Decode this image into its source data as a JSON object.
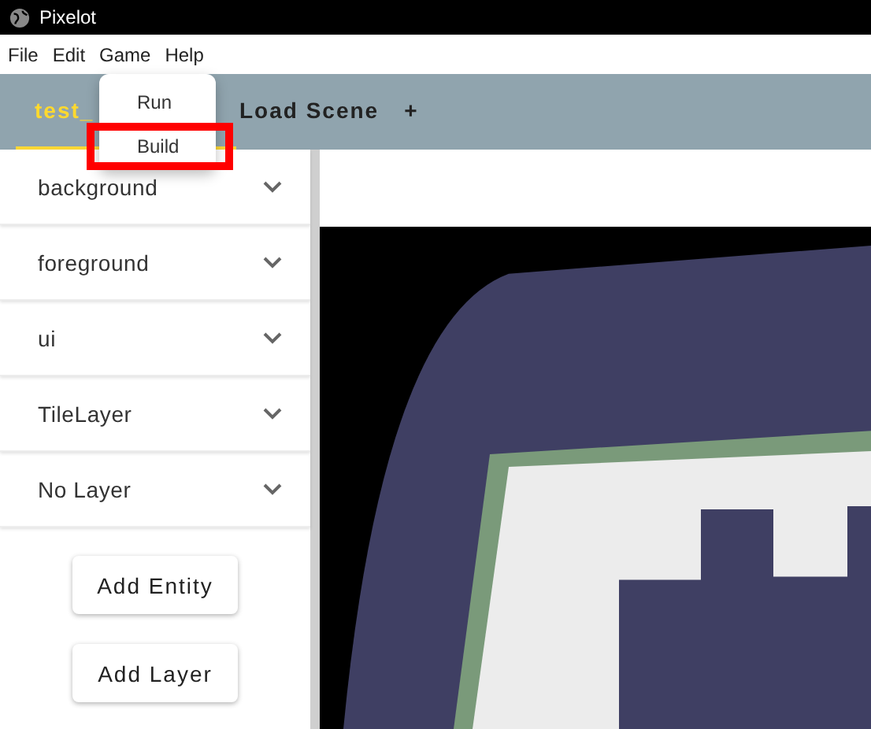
{
  "window": {
    "title": "Pixelot"
  },
  "menu_bar": [
    "File",
    "Edit",
    "Game",
    "Help"
  ],
  "open_menu": {
    "items": [
      {
        "label": "Run",
        "highlighted": false
      },
      {
        "label": "Build",
        "highlighted": true
      }
    ]
  },
  "tabs": [
    {
      "label": "test_",
      "selected": true
    },
    {
      "label": "Load Scene",
      "selected": false
    },
    {
      "label": "+",
      "selected": false
    }
  ],
  "layers": [
    {
      "name": "background",
      "expanded": false
    },
    {
      "name": "foreground",
      "expanded": false
    },
    {
      "name": "ui",
      "expanded": false
    },
    {
      "name": "TileLayer",
      "expanded": false
    },
    {
      "name": "No Layer",
      "expanded": false
    }
  ],
  "buttons": [
    "Add Entity",
    "Add Layer"
  ]
}
